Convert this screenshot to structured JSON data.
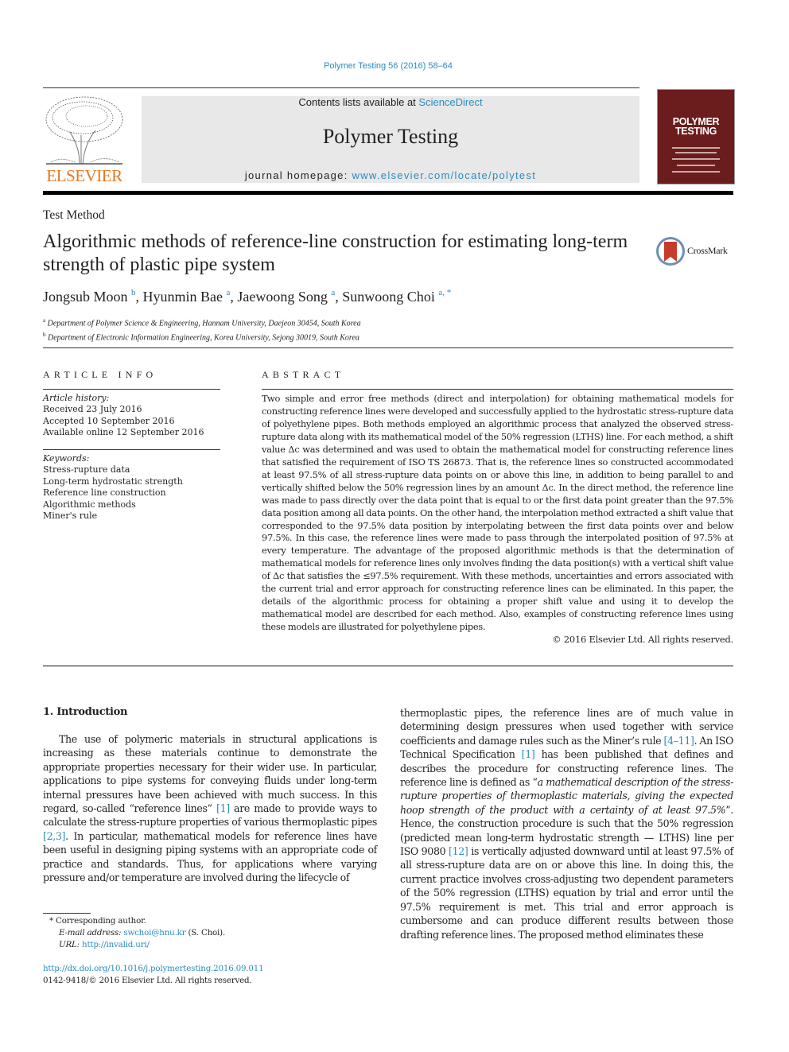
{
  "header": {
    "journal_reference": "Polymer Testing 56 (2016) 58–64",
    "contents_prefix": "Contents lists available at ",
    "contents_link": "ScienceDirect",
    "journal_title": "Polymer Testing",
    "homepage_prefix": "journal homepage: ",
    "homepage_link": "www.elsevier.com/locate/polytest",
    "publisher_logo_text": "ELSEVIER",
    "cover_title_line1": "POLYMER",
    "cover_title_line2": "TESTING",
    "brand_color": "#e87722",
    "link_color": "#2a8bbf",
    "cover_color": "#6b1d1d"
  },
  "article": {
    "type": "Test Method",
    "title": "Algorithmic methods of reference-line construction for estimating long-term strength of plastic pipe system",
    "crossmark_label": "CrossMark",
    "authors": [
      {
        "name": "Jongsub Moon",
        "sup": "b",
        "sep": ", "
      },
      {
        "name": "Hyunmin Bae",
        "sup": "a",
        "sep": ", "
      },
      {
        "name": "Jaewoong Song",
        "sup": "a",
        "sep": ", "
      },
      {
        "name": "Sunwoong Choi",
        "sup": "a, *",
        "sep": ""
      }
    ],
    "affiliations": [
      {
        "mark": "a",
        "text": "Department of Polymer Science & Engineering, Hannam University, Daejeon 30454, South Korea"
      },
      {
        "mark": "b",
        "text": "Department of Electronic Information Engineering, Korea University, Sejong 30019, South Korea"
      }
    ]
  },
  "article_info": {
    "label": "ARTICLE INFO",
    "history_heading": "Article history:",
    "history": [
      "Received 23 July 2016",
      "Accepted 10 September 2016",
      "Available online 12 September 2016"
    ],
    "keywords_heading": "Keywords:",
    "keywords": [
      "Stress-rupture data",
      "Long-term hydrostatic strength",
      "Reference line construction",
      "Algorithmic methods",
      "Miner's rule"
    ]
  },
  "abstract": {
    "label": "ABSTRACT",
    "text": "Two simple and error free methods (direct and interpolation) for obtaining mathematical models for constructing reference lines were developed and successfully applied to the hydrostatic stress-rupture data of polyethylene pipes. Both methods employed an algorithmic process that analyzed the observed stress-rupture data along with its mathematical model of the 50% regression (LTHS) line. For each method, a shift value Δc was determined and was used to obtain the mathematical model for constructing reference lines that satisfied the requirement of ISO TS 26873. That is, the reference lines so constructed accommodated at least 97.5% of all stress-rupture data points on or above this line, in addition to being parallel to and vertically shifted below the 50% regression lines by an amount Δc. In the direct method, the reference line was made to pass directly over the data point that is equal to or the first data point greater than the 97.5% data position among all data points. On the other hand, the interpolation method extracted a shift value that corresponded to the 97.5% data position by interpolating between the first data points over and below 97.5%. In this case, the reference lines were made to pass through the interpolated position of 97.5% at every temperature. The advantage of the proposed algorithmic methods is that the determination of mathematical models for reference lines only involves finding the data position(s) with a vertical shift value of Δc that satisfies the ≤97.5% requirement. With these methods, uncertainties and errors associated with the current trial and error approach for constructing reference lines can be eliminated. In this paper, the details of the algorithmic process for obtaining a proper shift value and using it to develop the mathematical model are described for each method. Also, examples of constructing reference lines using these models are illustrated for polyethylene pipes.",
    "copyright": "© 2016 Elsevier Ltd. All rights reserved."
  },
  "introduction": {
    "heading": "1.  Introduction",
    "left": [
      {
        "t": "The use of polymeric materials in structural applications is increasing as these materials continue to demonstrate the appropriate properties necessary for their wider use. In particular, applications to pipe systems for conveying fluids under long-term internal pressures have been achieved with much success. In this regard, so-called “reference lines” "
      },
      {
        "ref": "[1]"
      },
      {
        "t": " are made to provide ways to calculate the stress-rupture properties of various thermoplastic pipes "
      },
      {
        "ref": "[2,3]"
      },
      {
        "t": ". In particular, mathematical models for reference lines have been useful in designing piping systems with an appropriate code of practice and standards. Thus, for applications where varying pressure and/or temperature are involved during the lifecycle of"
      }
    ],
    "right": [
      {
        "t": "thermoplastic pipes, the reference lines are of much value in determining design pressures when used together with service coefficients and damage rules such as the Miner’s rule "
      },
      {
        "ref": "[4–11]"
      },
      {
        "t": ". An ISO Technical Specification "
      },
      {
        "ref": "[1]"
      },
      {
        "t": " has been published that defines and describes the procedure for constructing reference lines. The reference line is defined as “"
      },
      {
        "i": "a mathematical description of the stress-rupture properties of thermoplastic materials, giving the expected hoop strength of the product with a certainty of at least 97.5%"
      },
      {
        "t": "”. Hence, the construction procedure is such that the 50% regression (predicted mean long-term hydrostatic strength — LTHS) line per ISO 9080 "
      },
      {
        "ref": "[12]"
      },
      {
        "t": " is vertically adjusted downward until at least 97.5% of all stress-rupture data are on or above this line. In doing this, the current practice involves cross-adjusting two dependent parameters of the 50% regression (LTHS) equation by trial and error until the 97.5% requirement is met. This trial and error approach is cumbersome and can produce different results between those drafting reference lines. The proposed method eliminates these"
      }
    ]
  },
  "footnotes": {
    "corresponding": "*  Corresponding author.",
    "email_label": "E-mail address:",
    "email": "swchoi@hnu.kr",
    "email_suffix": " (S. Choi).",
    "url_label": "URL:",
    "url": "http://invalid.uri/",
    "doi": "http://dx.doi.org/10.1016/j.polymertesting.2016.09.011",
    "issn": "0142-9418/© 2016 Elsevier Ltd. All rights reserved."
  }
}
